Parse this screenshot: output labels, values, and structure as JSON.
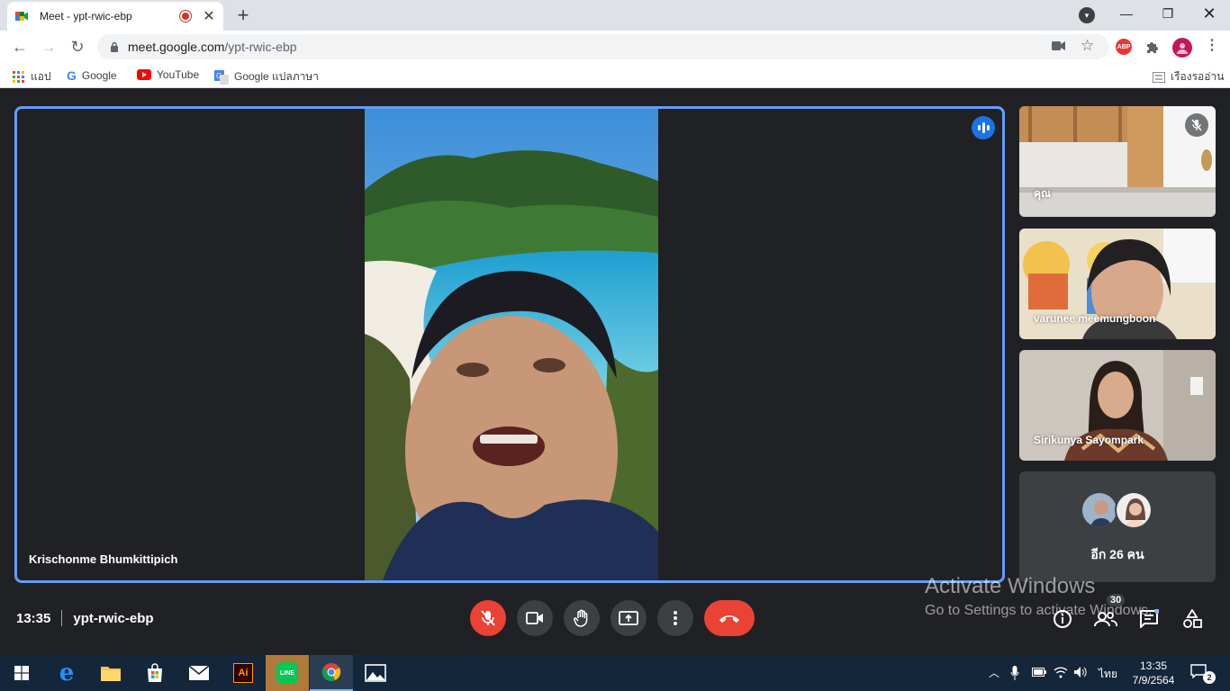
{
  "browser": {
    "tab_title": "Meet - ypt-rwic-ebp",
    "url_host": "meet.google.com",
    "url_path": "/ypt-rwic-ebp"
  },
  "bookmarks": [
    {
      "label": "แอป",
      "icon": "apps-grid-icon"
    },
    {
      "label": "Google",
      "icon": "google-icon"
    },
    {
      "label": "YouTube",
      "icon": "youtube-icon"
    },
    {
      "label": "Google แปลภาษา",
      "icon": "google-translate-icon"
    }
  ],
  "reading_list_label": "เรืองรออ่าน",
  "meet": {
    "main_participant": "Krischonme Bhumkittipich",
    "participants": [
      {
        "name": "คุณ"
      },
      {
        "name": "varunee meemungboon"
      },
      {
        "name": "Sirikunya Sayompark"
      }
    ],
    "others_label": "อีก 26 คน",
    "time": "13:35",
    "meeting_code": "ypt-rwic-ebp",
    "people_count": "30"
  },
  "activate_windows": {
    "title": "Activate Windows",
    "subtitle": "Go to Settings to activate Windows."
  },
  "taskbar": {
    "language": "ไทย",
    "clock_time": "13:35",
    "clock_date": "7/9/2564",
    "notification_count": "2"
  },
  "colors": {
    "meet_bg": "#202124",
    "accent_blue": "#1a73e8",
    "highlight_border": "#669df6",
    "danger_red": "#ea4335",
    "taskbar": "#14263a"
  }
}
